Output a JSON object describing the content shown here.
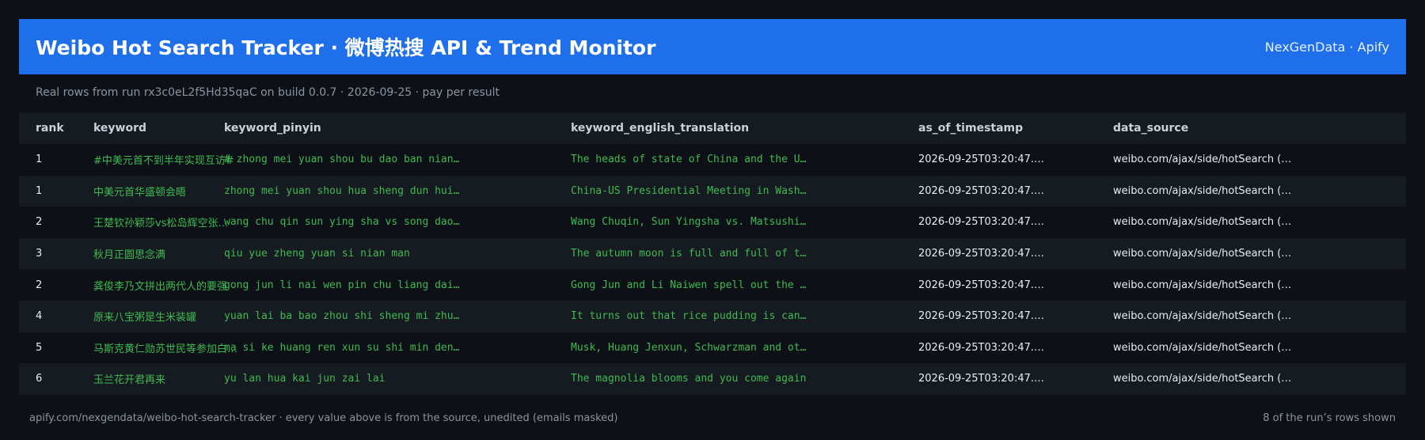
{
  "header": {
    "title": "Weibo Hot Search Tracker · 微博热搜 API & Trend Monitor",
    "brand": "NexGenData · Apify"
  },
  "subtitle": "Real rows from run rx3c0eL2f5Hd35qaC on build 0.0.7 · 2026-09-25 · pay per result",
  "table": {
    "columns": [
      "rank",
      "keyword",
      "keyword_pinyin",
      "keyword_english_translation",
      "as_of_timestamp",
      "data_source"
    ],
    "rows": [
      {
        "rank": "1",
        "keyword": "#中美元首不到半年实现互访#",
        "pinyin": "# zhong mei yuan shou bu dao ban nian…",
        "english": "The heads of state of China and the U…",
        "timestamp": "2026-09-25T03:20:47.…",
        "source": "weibo.com/ajax/side/hotSearch (…"
      },
      {
        "rank": "1",
        "keyword": "中美元首华盛顿会晤",
        "pinyin": "zhong mei yuan shou hua sheng dun hui…",
        "english": "China-US Presidential Meeting in Wash…",
        "timestamp": "2026-09-25T03:20:47.…",
        "source": "weibo.com/ajax/side/hotSearch (…"
      },
      {
        "rank": "2",
        "keyword": "王楚钦孙颖莎vs松岛辉空张…",
        "pinyin": "wang chu qin sun ying sha vs song dao…",
        "english": "Wang Chuqin, Sun Yingsha vs. Matsushi…",
        "timestamp": "2026-09-25T03:20:47.…",
        "source": "weibo.com/ajax/side/hotSearch (…"
      },
      {
        "rank": "3",
        "keyword": "秋月正圆思念满",
        "pinyin": "qiu yue zheng yuan si nian man",
        "english": "The autumn moon is full and full of t…",
        "timestamp": "2026-09-25T03:20:47.…",
        "source": "weibo.com/ajax/side/hotSearch (…"
      },
      {
        "rank": "2",
        "keyword": "龚俊李乃文拼出两代人的要强",
        "pinyin": "gong jun li nai wen pin chu liang dai…",
        "english": "Gong Jun and Li Naiwen spell out the …",
        "timestamp": "2026-09-25T03:20:47.…",
        "source": "weibo.com/ajax/side/hotSearch (…"
      },
      {
        "rank": "4",
        "keyword": "原来八宝粥是生米装罐",
        "pinyin": "yuan lai ba bao zhou shi sheng mi zhu…",
        "english": "It turns out that rice pudding is can…",
        "timestamp": "2026-09-25T03:20:47.…",
        "source": "weibo.com/ajax/side/hotSearch (…"
      },
      {
        "rank": "5",
        "keyword": "马斯克黄仁勋苏世民等参加白…",
        "pinyin": "ma si ke huang ren xun su shi min den…",
        "english": "Musk, Huang Jenxun, Schwarzman and ot…",
        "timestamp": "2026-09-25T03:20:47.…",
        "source": "weibo.com/ajax/side/hotSearch (…"
      },
      {
        "rank": "6",
        "keyword": "玉兰花开君再来",
        "pinyin": "yu lan hua kai jun zai lai",
        "english": "The magnolia blooms and you come again",
        "timestamp": "2026-09-25T03:20:47.…",
        "source": "weibo.com/ajax/side/hotSearch (…"
      }
    ]
  },
  "footer": {
    "left": "apify.com/nexgendata/weibo-hot-search-tracker  ·  every value above is from the source, unedited (emails masked)",
    "right": "8 of the run’s rows shown"
  },
  "colors": {
    "header_bg": "#1f6feb",
    "page_bg": "#0d1117",
    "stripe_bg": "#161b22",
    "accent_text": "#3fb950"
  }
}
